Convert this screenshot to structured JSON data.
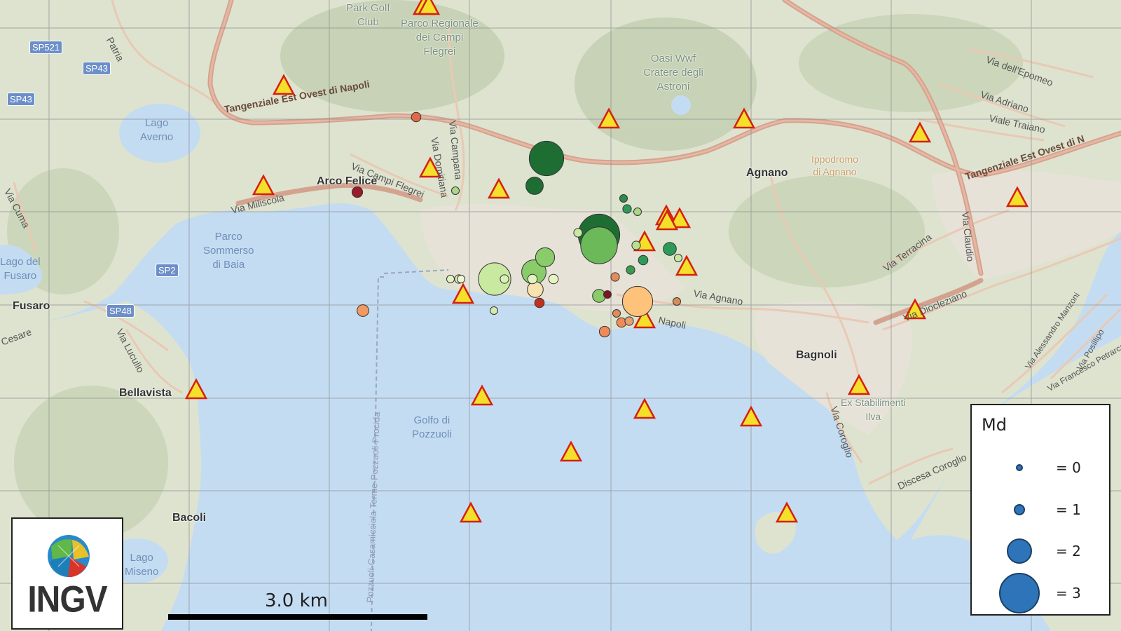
{
  "map": {
    "places": [
      {
        "id": "arco-felice",
        "label": "Arco Felice",
        "kind": "bold"
      },
      {
        "id": "agnano",
        "label": "Agnano",
        "kind": "bold"
      },
      {
        "id": "bagnoli",
        "label": "Bagnoli",
        "kind": "bold"
      },
      {
        "id": "bellavista",
        "label": "Bellavista",
        "kind": "bold"
      },
      {
        "id": "bacoli",
        "label": "Bacoli",
        "kind": "bold"
      },
      {
        "id": "fusaro",
        "label": "Fusaro",
        "kind": "bold"
      },
      {
        "id": "lago-averno",
        "label": "Lago\nAverno",
        "kind": "water"
      },
      {
        "id": "golfo-pozzuoli",
        "label": "Golfo di\nPozzuoli",
        "kind": "water"
      },
      {
        "id": "lago-del-fusaro",
        "label": "Lago del\nFusaro",
        "kind": "water"
      },
      {
        "id": "lago-miseno",
        "label": "Lago\nMiseno",
        "kind": "water"
      },
      {
        "id": "parco-sommerso",
        "label": "Parco\nSommerso\ndi Baia",
        "kind": "water"
      },
      {
        "id": "oasi-wwf",
        "label": "Oasi Wwf\nCratere degli\nAstroni",
        "kind": "faint"
      },
      {
        "id": "park-golf",
        "label": "Park Golf\nClub",
        "kind": "faint"
      },
      {
        "id": "parco-regionale",
        "label": "Parco Regionale\ndei Campi\nFlegrei",
        "kind": "faint"
      },
      {
        "id": "ippodromo",
        "label": "Ippodromo\ndi Agnano",
        "kind": "orange"
      },
      {
        "id": "ex-stabilimenti",
        "label": "Ex Stabilimenti\nIlva",
        "kind": "faint"
      }
    ],
    "roads": [
      {
        "id": "tangenziale-west",
        "label": "Tangenziale Est Ovest di Napoli"
      },
      {
        "id": "tangenziale-east",
        "label": "Tangenziale Est Ovest di N"
      },
      {
        "id": "via-campi-flegrei",
        "label": "Via Campi Flegrei"
      },
      {
        "id": "via-miliscola",
        "label": "Via Miliscola"
      },
      {
        "id": "via-domitiana",
        "label": "Via Domitiana"
      },
      {
        "id": "via-cuma",
        "label": "Via Cuma"
      },
      {
        "id": "via-lucullo",
        "label": "Via Lucullo"
      },
      {
        "id": "via-epomeo",
        "label": "Via dell'Epomeo"
      },
      {
        "id": "via-adriano",
        "label": "Via Adriano"
      },
      {
        "id": "viale-traiano",
        "label": "Viale Traiano"
      },
      {
        "id": "via-terracina",
        "label": "Via Terracina"
      },
      {
        "id": "via-claudio",
        "label": "Via Claudio"
      },
      {
        "id": "via-diocleziano",
        "label": "Via Diocleziano"
      },
      {
        "id": "via-coroglio",
        "label": "Via Coroglio"
      },
      {
        "id": "discesa-coroglio",
        "label": "Discesa Coroglio"
      },
      {
        "id": "via-napoli",
        "label": "Napoli"
      },
      {
        "id": "via-agnano",
        "label": "Via Agnano"
      },
      {
        "id": "via-campana",
        "label": "Via Campana"
      },
      {
        "id": "via-cesare",
        "label": "Cesare"
      },
      {
        "id": "via-manzoni",
        "label": "Via Alessandro Manzoni"
      },
      {
        "id": "via-petrarca",
        "label": "Via Francesco Petrarca"
      },
      {
        "id": "via-posillipo",
        "label": "Via Posillipo"
      },
      {
        "id": "via-pozzuoli-ferry",
        "label": "Pozzuoli-Casamicciola Terme-Pozzuoli-Procida"
      },
      {
        "id": "via-libertà",
        "label": "Patria"
      }
    ],
    "shields": [
      "SP521",
      "SP43",
      "SP43",
      "SP2",
      "SP48"
    ],
    "scale_label": "3.0 km",
    "logo_text": "INGV",
    "legend": {
      "title": "Md",
      "rows": [
        {
          "label": "= 0",
          "md": 0
        },
        {
          "label": "= 1",
          "md": 1
        },
        {
          "label": "= 2",
          "md": 2
        },
        {
          "label": "= 3",
          "md": 3
        }
      ]
    },
    "colors": {
      "water": "#c4dcf2",
      "land": "#dde3cf",
      "hills": "#c7d2b6",
      "major_road": "#d4a38f",
      "minor_road": "#e9c9b4",
      "grid": "#8d8d8d",
      "station_fill": "#f4e02a",
      "station_edge": "#d61f12",
      "legend_dot": "#2e74b8"
    },
    "stations": 26,
    "events": [
      {
        "md": 2.1,
        "color": "#1e6e34"
      },
      {
        "md": 1.2,
        "color": "#1e6e34"
      },
      {
        "md": 2.4,
        "color": "#1e6e34"
      },
      {
        "md": 2.2,
        "color": "#6cb95a"
      },
      {
        "md": 2.0,
        "color": "#c9e8a0"
      },
      {
        "md": 1.6,
        "color": "#8acb6a"
      },
      {
        "md": 1.3,
        "color": "#8acb6a"
      },
      {
        "md": 1.9,
        "color": "#ffc27a"
      },
      {
        "md": 1.1,
        "color": "#f8e2b0"
      },
      {
        "md": 0.9,
        "color": "#8acb6a"
      },
      {
        "md": 0.9,
        "color": "#2e9a58"
      },
      {
        "md": 0.5,
        "color": "#2e9a58"
      },
      {
        "md": 0.6,
        "color": "#c2301f"
      },
      {
        "md": 0.4,
        "color": "#7e1424"
      },
      {
        "md": 0.7,
        "color": "#9a1b2a"
      },
      {
        "md": 0.8,
        "color": "#f09a62"
      },
      {
        "md": 0.7,
        "color": "#f08b58"
      },
      {
        "md": 0.6,
        "color": "#f08b58"
      },
      {
        "md": 0.6,
        "color": "#e06a45"
      },
      {
        "md": 0.5,
        "color": "#e68a5a"
      },
      {
        "md": 0.4,
        "color": "#d98c5a"
      },
      {
        "md": 0.6,
        "color": "#2e9a58"
      },
      {
        "md": 0.5,
        "color": "#3a9a4e"
      },
      {
        "md": 0.4,
        "color": "#2e8a4a"
      },
      {
        "md": 0.4,
        "color": "#a8d888"
      },
      {
        "md": 0.5,
        "color": "#c9e8a0"
      },
      {
        "md": 0.5,
        "color": "#d8f0b0"
      },
      {
        "md": 0.6,
        "color": "#e8f4c0"
      },
      {
        "md": 0.5,
        "color": "#dcefb8"
      },
      {
        "md": 0.4,
        "color": "#e2f2c0"
      },
      {
        "md": 0.4,
        "color": "#eef7d0"
      },
      {
        "md": 0.4,
        "color": "#c9e8a0"
      },
      {
        "md": 0.6,
        "color": "#e2f2c0"
      },
      {
        "md": 0.5,
        "color": "#b8e090"
      },
      {
        "md": 0.4,
        "color": "#d0eab0"
      },
      {
        "md": 0.4,
        "color": "#a8d888"
      },
      {
        "md": 0.5,
        "color": "#e6a070"
      },
      {
        "md": 0.4,
        "color": "#e28a58"
      }
    ]
  }
}
